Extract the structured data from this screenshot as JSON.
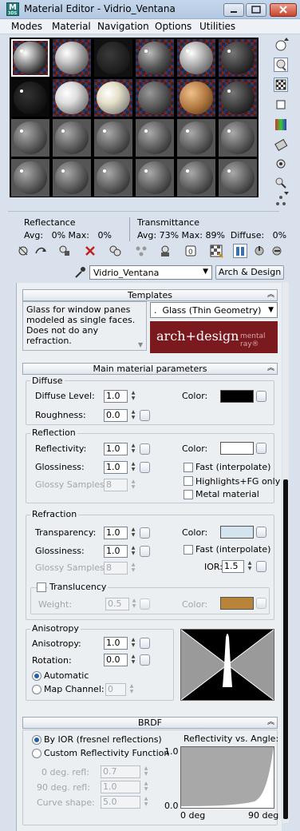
{
  "window": {
    "title": "Material Editor - Vidrio_Ventana",
    "app_icon": "3ds-max-icon",
    "app_icon_text": "M",
    "app_icon_sub": "3DS"
  },
  "menu": [
    "Modes",
    "Material",
    "Navigation",
    "Options",
    "Utilities"
  ],
  "reflectance": {
    "label": "Reflectance",
    "avg": "Avg:   0% Max:   0%"
  },
  "transmittance": {
    "label": "Transmittance",
    "avg": "Avg: 73% Max: 89%  Diffuse:   0%"
  },
  "material": {
    "name": "Vidrio_Ventana",
    "type_button": "Arch & Design"
  },
  "templates": {
    "header": "Templates",
    "description": "Glass for window panes modeled as single faces. Does not do any refraction.",
    "selected": ".  Glass (Thin Geometry)",
    "banner_main": "arch+design",
    "banner_sub": "mental ray®"
  },
  "main_params": {
    "header": "Main material parameters",
    "diffuse": {
      "title": "Diffuse",
      "level_label": "Diffuse Level:",
      "level": "1.0",
      "roughness_label": "Roughness:",
      "roughness": "0.0",
      "color_label": "Color:",
      "color": "#000000"
    },
    "reflection": {
      "title": "Reflection",
      "reflectivity_label": "Reflectivity:",
      "reflectivity": "1.0",
      "glossiness_label": "Glossiness:",
      "glossiness": "1.0",
      "samples_label": "Glossy Samples:",
      "samples": "8",
      "color_label": "Color:",
      "color": "#ffffff",
      "fast_label": "Fast (interpolate)",
      "highlights_label": "Highlights+FG only",
      "metal_label": "Metal material"
    },
    "refraction": {
      "title": "Refraction",
      "transparency_label": "Transparency:",
      "transparency": "1.0",
      "glossiness_label": "Glossiness:",
      "glossiness": "1.0",
      "samples_label": "Glossy Samples:",
      "samples": "8",
      "color_label": "Color:",
      "color": "#d4e4ef",
      "fast_label": "Fast (interpolate)",
      "ior_label": "IOR:",
      "ior": "1.5"
    },
    "translucency": {
      "title": "Translucency",
      "weight_label": "Weight:",
      "weight": "0.5",
      "color_label": "Color:",
      "color": "#b88439"
    },
    "anisotropy": {
      "title": "Anisotropy",
      "anisotropy_label": "Anisotropy:",
      "anisotropy": "1.0",
      "rotation_label": "Rotation:",
      "rotation": "0.0",
      "automatic_label": "Automatic",
      "map_channel_label": "Map Channel:",
      "map_channel": "0"
    }
  },
  "brdf": {
    "header": "BRDF",
    "by_ior_label": "By IOR (fresnel reflections)",
    "custom_label": "Custom Reflectivity Function",
    "deg0_label": "0 deg. refl:",
    "deg0": "0.7",
    "deg90_label": "90 deg. refl:",
    "deg90": "1.0",
    "curve_label": "Curve shape:",
    "curve": "5.0",
    "graph_title": "Reflectivity vs. Angle:",
    "y_max": "1.0",
    "y_min": "0.0",
    "x_min": "0 deg",
    "x_max": "90 deg"
  }
}
